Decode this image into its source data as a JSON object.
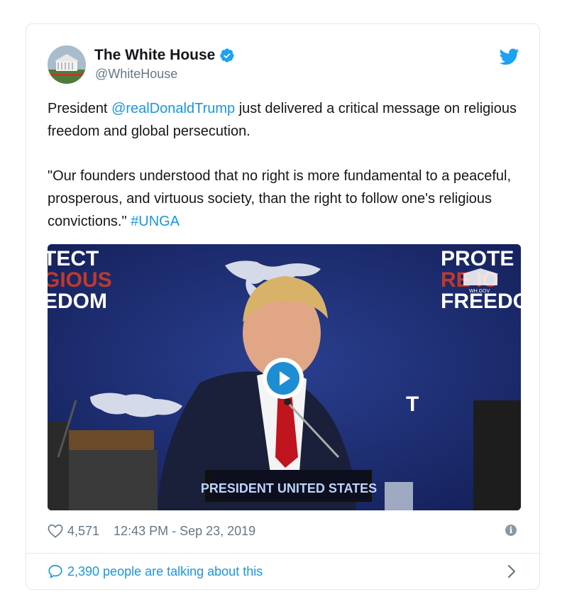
{
  "tweet": {
    "display_name": "The White House",
    "handle": "@WhiteHouse",
    "text": {
      "line1_prefix": "President ",
      "mention": "@realDonaldTrump",
      "line1_suffix": " just delivered a critical message on religious freedom and global persecution.",
      "quote": "\"Our founders understood that no right is more fundamental to a peaceful, prosperous, and virtuous society, than the right to follow one's religious convictions.\" ",
      "hashtag": "#UNGA"
    },
    "media": {
      "backdrop_left": [
        "TECT",
        "GIOUS",
        "EDOM"
      ],
      "backdrop_right": [
        "PROTE",
        "RE   IO",
        "FREEDO"
      ],
      "backdrop_mid": "T",
      "nameplate": "PRESIDENT UNITED STATES",
      "watermark": "WH.GOV"
    },
    "likes": "4,571",
    "timestamp": "12:43 PM - Sep 23, 2019",
    "talking": "2,390 people are talking about this"
  },
  "colors": {
    "link": "#1b95e0",
    "verified": "#1da1f2",
    "muted": "#657786"
  },
  "icons": [
    "verified-badge-icon",
    "twitter-bird-icon",
    "heart-icon",
    "info-icon",
    "speech-bubble-icon",
    "chevron-right-icon",
    "play-icon"
  ]
}
